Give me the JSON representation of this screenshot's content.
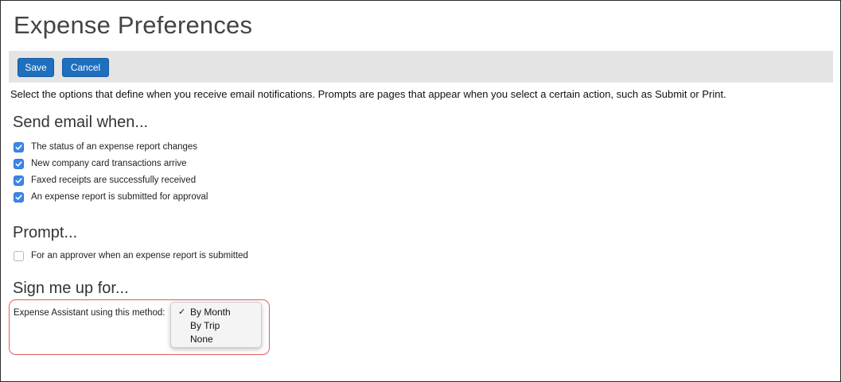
{
  "page": {
    "title": "Expense Preferences"
  },
  "toolbar": {
    "save_label": "Save",
    "cancel_label": "Cancel"
  },
  "intro_text": "Select the options that define when you receive email notifications. Prompts are pages that appear when you select a certain action, such as Submit or Print.",
  "email_section": {
    "heading": "Send email when...",
    "options": [
      {
        "label": "The status of an expense report changes",
        "checked": true
      },
      {
        "label": "New company card transactions arrive",
        "checked": true
      },
      {
        "label": "Faxed receipts are successfully received",
        "checked": true
      },
      {
        "label": "An expense report is submitted for approval",
        "checked": true
      }
    ]
  },
  "prompt_section": {
    "heading": "Prompt...",
    "options": [
      {
        "label": "For an approver when an expense report is submitted",
        "checked": false
      }
    ]
  },
  "signup_section": {
    "heading": "Sign me up for...",
    "method_label": "Expense Assistant using this method:",
    "selected_value": "By Month",
    "options": [
      {
        "label": "By Month",
        "selected": true
      },
      {
        "label": "By Trip",
        "selected": false
      },
      {
        "label": "None",
        "selected": false
      }
    ]
  },
  "colors": {
    "button": "#1f6fbf",
    "checkbox_checked": "#3b86e6",
    "highlight_border": "#e45a5a",
    "toolbar_bg": "#e4e4e4"
  },
  "icons": {
    "checked": "checkmark-icon",
    "selected_option": "checkmark-icon"
  }
}
